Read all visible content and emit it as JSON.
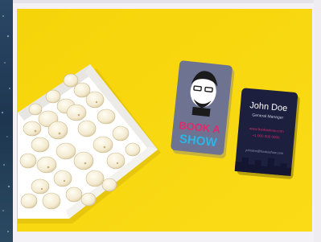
{
  "image": {
    "description": "Photo of a bowl of popcorn and two business cards on a yellow background inside a white frame"
  },
  "cards": {
    "front": {
      "logo_line1": "BOOK A",
      "logo_line2": "SHOW"
    },
    "back": {
      "name": "John Doe",
      "title": "General Manager",
      "line1": "www.bookashow.com",
      "line2": "+1 000 000 0000",
      "footer": "johndoe@bookashow.com"
    }
  },
  "colors": {
    "background_yellow": "#f8d80c",
    "frame_white": "#f3f1f5",
    "left_band": "#243e5a",
    "card_front": "#6c7190",
    "card_back": "#1c1f3d",
    "logo_pink": "#e2296b",
    "logo_blue": "#2cb5e7"
  }
}
